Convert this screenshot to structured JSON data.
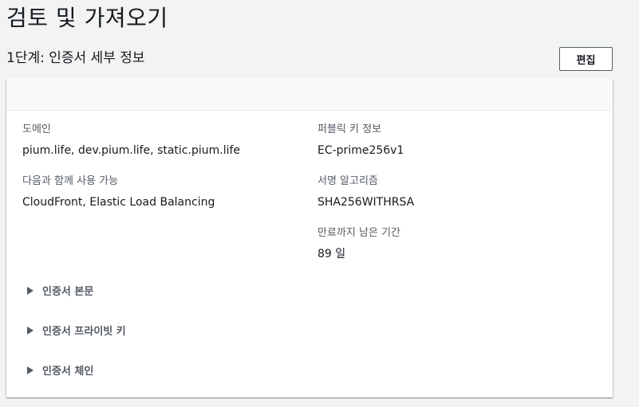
{
  "page": {
    "title": "검토 및 가져오기"
  },
  "step": {
    "title": "1단계: 인증서 세부 정보",
    "edit_label": "편집"
  },
  "details": {
    "domain_label": "도메인",
    "domain_value": "pium.life, dev.pium.life, static.pium.life",
    "usable_with_label": "다음과 함께 사용 가능",
    "usable_with_value": "CloudFront, Elastic Load Balancing",
    "public_key_label": "퍼블릭 키 정보",
    "public_key_value": "EC-prime256v1",
    "signature_label": "서명 알고리즘",
    "signature_value": "SHA256WITHRSA",
    "expiry_label": "만료까지 남은 기간",
    "expiry_value": "89 일"
  },
  "expanders": [
    {
      "label": "인증서 본문",
      "icon": "caret-right-icon"
    },
    {
      "label": "인증서 프라이빗 키",
      "icon": "caret-right-icon"
    },
    {
      "label": "인증서 체인",
      "icon": "caret-right-icon"
    }
  ],
  "colors": {
    "background": "#f2f3f3",
    "text": "#16191f",
    "label": "#545b64",
    "panel": "#ffffff"
  }
}
